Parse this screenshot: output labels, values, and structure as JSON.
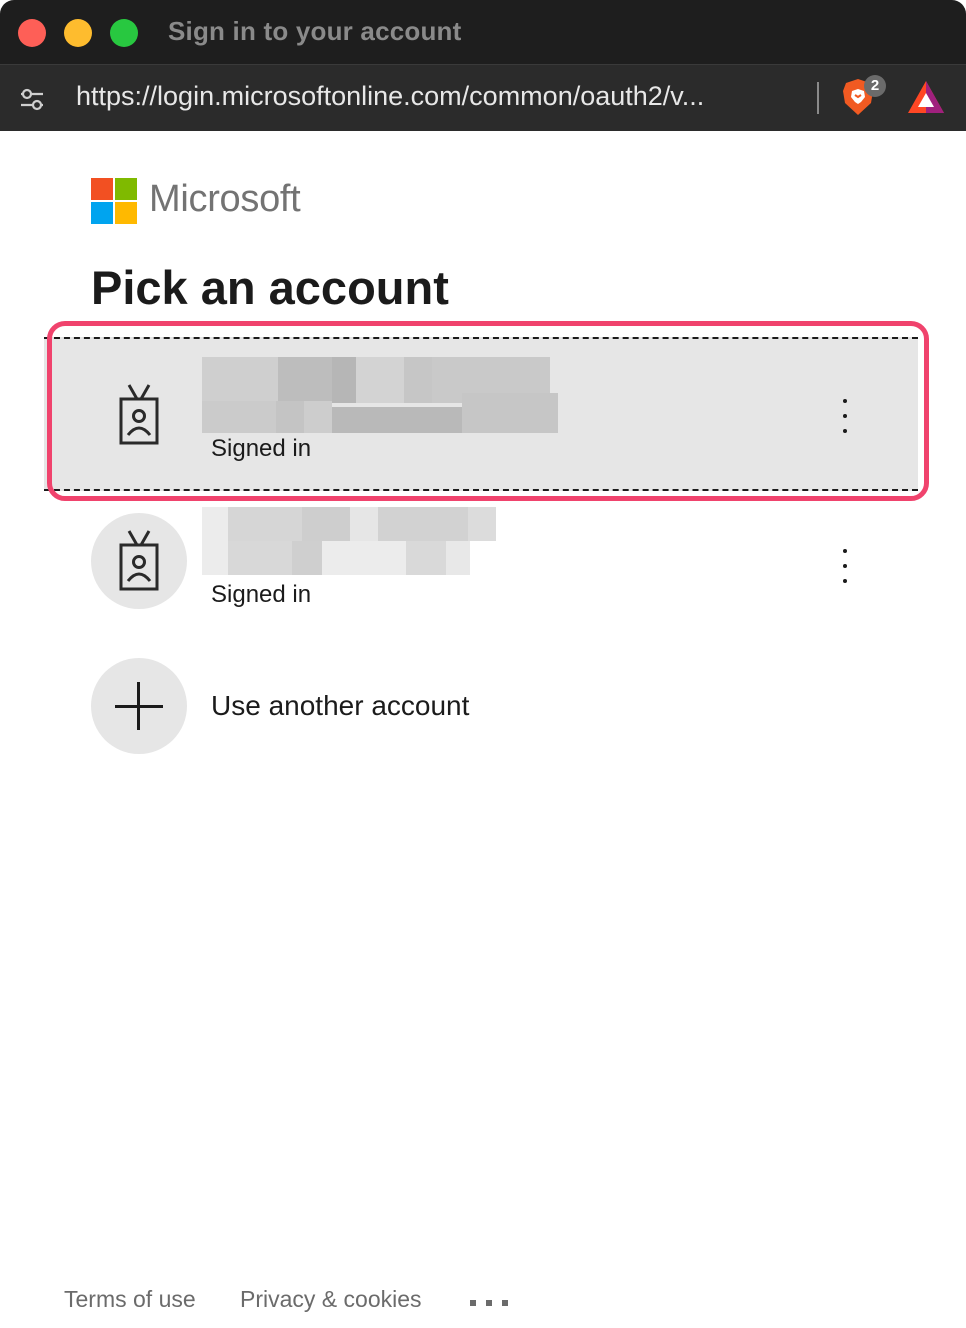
{
  "window": {
    "title": "Sign in to your account"
  },
  "browser": {
    "url": "https://login.microsoftonline.com/common/oauth2/v...",
    "shield_count": "2"
  },
  "brand": {
    "name": "Microsoft",
    "logo_colors": [
      "#f25022",
      "#7fba00",
      "#00a4ef",
      "#ffb900"
    ]
  },
  "page": {
    "title": "Pick an account"
  },
  "accounts": [
    {
      "status": "Signed in",
      "icon": "badge-person-icon",
      "name_redacted": true,
      "selected": true
    },
    {
      "status": "Signed in",
      "icon": "badge-person-icon",
      "name_redacted": true,
      "selected": false
    }
  ],
  "add_account": {
    "label": "Use another account",
    "icon": "plus-icon"
  },
  "footer": {
    "terms": "Terms of use",
    "privacy": "Privacy & cookies"
  },
  "colors": {
    "highlight": "#f0436d",
    "selected_row": "#e6e6e6"
  }
}
